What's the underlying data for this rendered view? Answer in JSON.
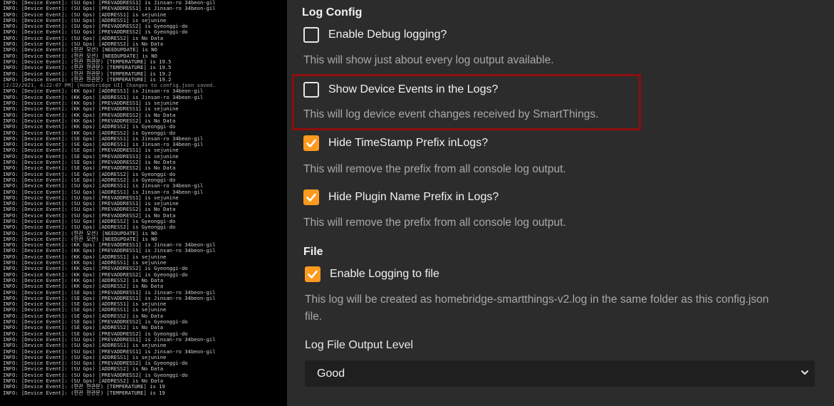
{
  "console": {
    "lines": [
      "INFO: [Device Event]: (SU Gps) [PREVADDRESS1] is Jinsan-ro 34beon-gil",
      "INFO: [Device Event]: (SU Gps) [PREVADDRESS1] is Jinsan-ro 34beon-gil",
      "INFO: [Device Event]: (SU Gps) [ADDRESS1] is sejunine",
      "INFO: [Device Event]: (SU Gps) [ADDRESS1] is sejunine",
      "INFO: [Device Event]: (SU Gps) [PREVADDRESS2] is Gyeonggi-do",
      "INFO: [Device Event]: (SU Gps) [PREVADDRESS2] is Gyeonggi-do",
      "INFO: [Device Event]: (SU Gps) [ADDRESS2] is No Data",
      "INFO: [Device Event]: (SU Gps) [ADDRESS2] is No Data",
      "INFO: [Device Event]: (현관 모션) [NEEDUPDATE] is NO",
      "INFO: [Device Event]: (현관 모션) [NEEDUPDATE] is NO",
      "INFO: [Device Event]: (현관 현관문) [TEMPERATURE] is 19.5",
      "INFO: [Device Event]: (현관 현관문) [TEMPERATURE] is 19.5",
      "INFO: [Device Event]: (현관 현관문) [TEMPERATURE] is 19.2",
      "INFO: [Device Event]: (현관 현관문) [TEMPERATURE] is 19.2",
      "[2/22/2021, 4:22:07 PM] [Homebridge UI] Changes to config.json saved.",
      "INFO: [Device Event]: (KK Gps) [ADDRESS1] is Jinsan-ro 34beon-gil",
      "INFO: [Device Event]: (KK Gps) [ADDRESS1] is Jinsan-ro 34beon-gil",
      "INFO: [Device Event]: (KK Gps) [PREVADDRESS1] is sejunine",
      "INFO: [Device Event]: (KK Gps) [PREVADDRESS1] is sejunine",
      "INFO: [Device Event]: (KK Gps) [PREVADDRESS2] is No Data",
      "INFO: [Device Event]: (KK Gps) [PREVADDRESS2] is No Data",
      "INFO: [Device Event]: (KK Gps) [ADDRESS2] is Gyeonggi-do",
      "INFO: [Device Event]: (KK Gps) [ADDRESS2] is Gyeonggi-do",
      "INFO: [Device Event]: (SE Gps) [ADDRESS1] is Jinsan-ro 34beon-gil",
      "INFO: [Device Event]: (SE Gps) [ADDRESS1] is Jinsan-ro 34beon-gil",
      "INFO: [Device Event]: (SE Gps) [PREVADDRESS1] is sejunine",
      "INFO: [Device Event]: (SE Gps) [PREVADDRESS1] is sejunine",
      "INFO: [Device Event]: (SE Gps) [PREVADDRESS2] is No Data",
      "INFO: [Device Event]: (SE Gps) [PREVADDRESS2] is No Data",
      "INFO: [Device Event]: (SE Gps) [ADDRESS2] is Gyeonggi-do",
      "INFO: [Device Event]: (SE Gps) [ADDRESS2] is Gyeonggi-do",
      "INFO: [Device Event]: (SU Gps) [ADDRESS1] is Jinsan-ro 34beon-gil",
      "INFO: [Device Event]: (SU Gps) [ADDRESS1] is Jinsan-ro 34beon-gil",
      "INFO: [Device Event]: (SU Gps) [PREVADDRESS1] is sejunine",
      "INFO: [Device Event]: (SU Gps) [PREVADDRESS1] is sejunine",
      "INFO: [Device Event]: (SU Gps) [PREVADDRESS2] is No Data",
      "INFO: [Device Event]: (SU Gps) [PREVADDRESS2] is No Data",
      "INFO: [Device Event]: (SU Gps) [ADDRESS2] is Gyeonggi-do",
      "INFO: [Device Event]: (SU Gps) [ADDRESS2] is Gyeonggi-do",
      "INFO: [Device Event]: (현관 모션) [NEEDUPDATE] is NO",
      "INFO: [Device Event]: (현관 모션) [NEEDUPDATE] is NO",
      "INFO: [Device Event]: (KK Gps) [PREVADDRESS1] is Jinsan-ro 34beon-gil",
      "INFO: [Device Event]: (KK Gps) [PREVADDRESS1] is Jinsan-ro 34beon-gil",
      "INFO: [Device Event]: (KK Gps) [ADDRESS1] is sejunine",
      "INFO: [Device Event]: (KK Gps) [ADDRESS1] is sejunine",
      "INFO: [Device Event]: (KK Gps) [PREVADDRESS2] is Gyeonggi-do",
      "INFO: [Device Event]: (KK Gps) [PREVADDRESS2] is Gyeonggi-do",
      "INFO: [Device Event]: (KK Gps) [ADDRESS2] is No Data",
      "INFO: [Device Event]: (KK Gps) [ADDRESS2] is No Data",
      "INFO: [Device Event]: (SE Gps) [PREVADDRESS1] is Jinsan-ro 34beon-gil",
      "INFO: [Device Event]: (SE Gps) [PREVADDRESS1] is Jinsan-ro 34beon-gil",
      "INFO: [Device Event]: (SE Gps) [ADDRESS1] is sejunine",
      "INFO: [Device Event]: (SE Gps) [ADDRESS1] is sejunine",
      "INFO: [Device Event]: (SE Gps) [ADDRESS2] is No Data",
      "INFO: [Device Event]: (SE Gps) [PREVADDRESS2] is Gyeonggi-do",
      "INFO: [Device Event]: (SE Gps) [ADDRESS2] is No Data",
      "INFO: [Device Event]: (SE Gps) [PREVADDRESS2] is Gyeonggi-do",
      "INFO: [Device Event]: (SU Gps) [PREVADDRESS1] is Jinsan-ro 34beon-gil",
      "INFO: [Device Event]: (SU Gps) [ADDRESS1] is sejunine",
      "INFO: [Device Event]: (SU Gps) [PREVADDRESS1] is Jinsan-ro 34beon-gil",
      "INFO: [Device Event]: (SU Gps) [ADDRESS1] is sejunine",
      "INFO: [Device Event]: (SU Gps) [PREVADDRESS2] is Gyeonggi-do",
      "INFO: [Device Event]: (SU Gps) [ADDRESS2] is No Data",
      "INFO: [Device Event]: (SU Gps) [PREVADDRESS2] is Gyeonggi-do",
      "INFO: [Device Event]: (SU Gps) [ADDRESS2] is No Data",
      "INFO: [Device Event]: (현관 현관문) [TEMPERATURE] is 19",
      "INFO: [Device Event]: (현관 현관문) [TEMPERATURE] is 19"
    ]
  },
  "log_config": {
    "title": "Log Config",
    "options": [
      {
        "label": "Enable Debug logging?",
        "checked": false,
        "help": "This will show just about every log output available."
      },
      {
        "label": "Show Device Events in the Logs?",
        "checked": false,
        "help": "This will log device event changes received by SmartThings."
      },
      {
        "label": "Hide TimeStamp Prefix inLogs?",
        "checked": true,
        "help": "This will remove the prefix from all console log output."
      },
      {
        "label": "Hide Plugin Name Prefix in Logs?",
        "checked": true,
        "help": "This will remove the prefix from all console log output."
      }
    ]
  },
  "file": {
    "title": "File",
    "enable_logging": {
      "label": "Enable Logging to file",
      "checked": true,
      "help_line1": "This log will be created as homebridge-smartthings-v2.log in the same folder as this config.json",
      "help_line2": "file."
    },
    "output_level": {
      "label": "Log File Output Level",
      "value": "Good"
    }
  },
  "colors": {
    "accent": "#ff9a1f",
    "highlight_border": "#8f0d0d",
    "panel_bg": "#2c2c2c",
    "console_bg": "#000000"
  }
}
